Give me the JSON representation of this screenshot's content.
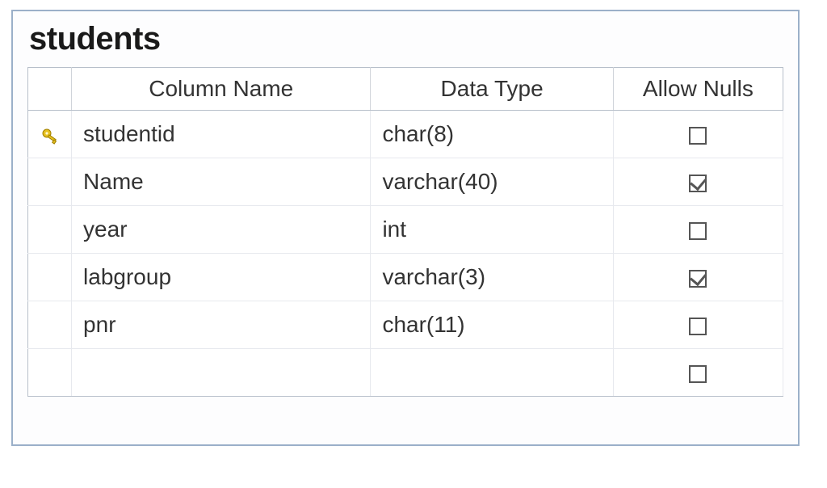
{
  "table": {
    "name": "students",
    "headers": {
      "column_name": "Column Name",
      "data_type": "Data Type",
      "allow_nulls": "Allow Nulls"
    },
    "rows": [
      {
        "is_primary_key": true,
        "column_name": "studentid",
        "data_type": "char(8)",
        "allow_nulls": false
      },
      {
        "is_primary_key": false,
        "column_name": "Name",
        "data_type": "varchar(40)",
        "allow_nulls": true
      },
      {
        "is_primary_key": false,
        "column_name": "year",
        "data_type": "int",
        "allow_nulls": false
      },
      {
        "is_primary_key": false,
        "column_name": "labgroup",
        "data_type": "varchar(3)",
        "allow_nulls": true
      },
      {
        "is_primary_key": false,
        "column_name": "pnr",
        "data_type": "char(11)",
        "allow_nulls": false
      },
      {
        "is_primary_key": false,
        "column_name": "",
        "data_type": "",
        "allow_nulls": false
      }
    ]
  },
  "icons": {
    "primary_key": "key-icon"
  }
}
